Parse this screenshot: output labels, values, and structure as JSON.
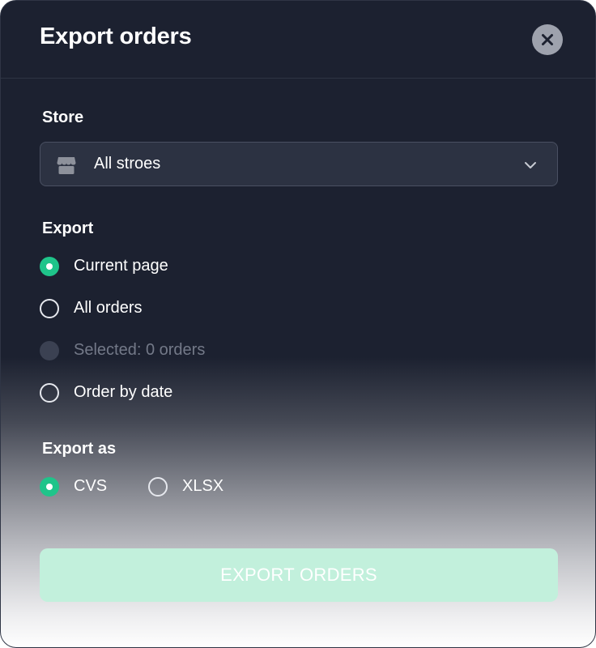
{
  "dialog": {
    "title": "Export orders"
  },
  "store": {
    "label": "Store",
    "selected": "All stroes",
    "icon": "store-icon"
  },
  "export_scope": {
    "label": "Export",
    "options": [
      {
        "label": "Current page",
        "checked": true,
        "disabled": false
      },
      {
        "label": "All orders",
        "checked": false,
        "disabled": false
      },
      {
        "label": "Selected: 0 orders",
        "checked": false,
        "disabled": true
      },
      {
        "label": "Order by date",
        "checked": false,
        "disabled": false
      }
    ]
  },
  "export_format": {
    "label": "Export as",
    "options": [
      {
        "label": "CVS",
        "checked": true
      },
      {
        "label": "XLSX",
        "checked": false
      }
    ]
  },
  "actions": {
    "export_label": "EXPORT ORDERS"
  },
  "colors": {
    "background": "#1c2130",
    "accent": "#1fc48a",
    "button": "#c2f0dc"
  }
}
